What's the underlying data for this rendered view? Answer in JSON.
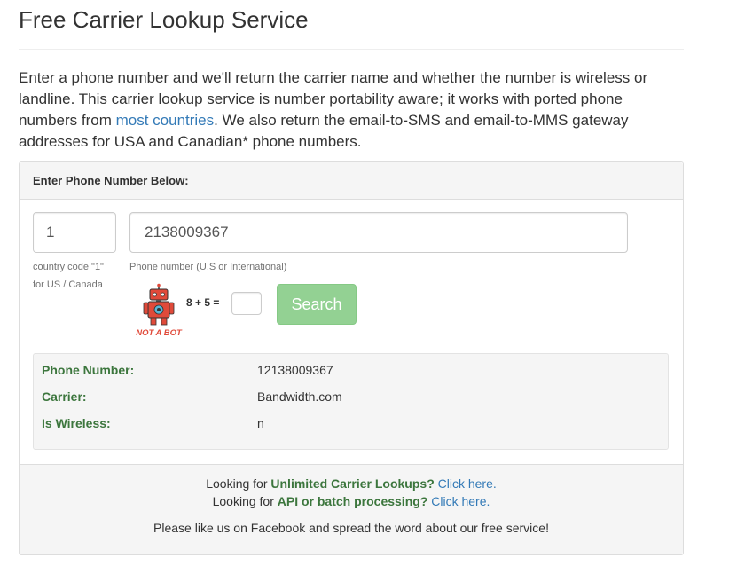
{
  "page": {
    "title": "Free Carrier Lookup Service",
    "intro_before_link": "Enter a phone number and we'll return the carrier name and whether the number is wireless or landline. This carrier lookup service is number portability aware; it works with ported phone numbers from ",
    "intro_link": "most countries",
    "intro_after_link": ". We also return the email-to-SMS and email-to-MMS gateway addresses for USA and Canadian* phone numbers."
  },
  "form": {
    "heading": "Enter Phone Number Below:",
    "country_code_value": "1",
    "country_code_help_1": "country code \"1\"",
    "country_code_help_2": "for US / Canada",
    "phone_value": "2138009367",
    "phone_help": "Phone number (U.S or International)",
    "robot_caption": "NOT A BOT",
    "captcha_question": "8 + 5 =",
    "captcha_value": "",
    "search_label": "Search"
  },
  "results": [
    {
      "label": "Phone Number:",
      "value": "12138009367"
    },
    {
      "label": "Carrier:",
      "value": "Bandwidth.com"
    },
    {
      "label": "Is Wireless:",
      "value": "n"
    }
  ],
  "footer": {
    "line1_prefix": "Looking for ",
    "line1_strong": "Unlimited Carrier Lookups?",
    "line1_link": "Click here.",
    "line2_prefix": "Looking for ",
    "line2_strong": "API or batch processing?",
    "line2_link": "Click here.",
    "line3": "Please like us on Facebook and spread the word about our free service!"
  },
  "colors": {
    "link": "#337ab7",
    "label_green": "#3c763d",
    "search_button": "#93d193",
    "robot_red": "#e04a3a"
  },
  "icons": {
    "robot": "robot-icon"
  }
}
